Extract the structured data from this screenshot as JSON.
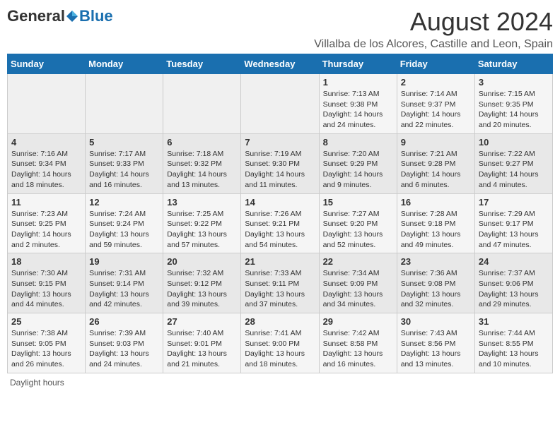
{
  "header": {
    "logo_general": "General",
    "logo_blue": "Blue",
    "main_title": "August 2024",
    "subtitle": "Villalba de los Alcores, Castille and Leon, Spain"
  },
  "weekdays": [
    "Sunday",
    "Monday",
    "Tuesday",
    "Wednesday",
    "Thursday",
    "Friday",
    "Saturday"
  ],
  "weeks": [
    [
      {
        "day": "",
        "sunrise": "",
        "sunset": "",
        "daylight": ""
      },
      {
        "day": "",
        "sunrise": "",
        "sunset": "",
        "daylight": ""
      },
      {
        "day": "",
        "sunrise": "",
        "sunset": "",
        "daylight": ""
      },
      {
        "day": "",
        "sunrise": "",
        "sunset": "",
        "daylight": ""
      },
      {
        "day": "1",
        "sunrise": "Sunrise: 7:13 AM",
        "sunset": "Sunset: 9:38 PM",
        "daylight": "Daylight: 14 hours and 24 minutes."
      },
      {
        "day": "2",
        "sunrise": "Sunrise: 7:14 AM",
        "sunset": "Sunset: 9:37 PM",
        "daylight": "Daylight: 14 hours and 22 minutes."
      },
      {
        "day": "3",
        "sunrise": "Sunrise: 7:15 AM",
        "sunset": "Sunset: 9:35 PM",
        "daylight": "Daylight: 14 hours and 20 minutes."
      }
    ],
    [
      {
        "day": "4",
        "sunrise": "Sunrise: 7:16 AM",
        "sunset": "Sunset: 9:34 PM",
        "daylight": "Daylight: 14 hours and 18 minutes."
      },
      {
        "day": "5",
        "sunrise": "Sunrise: 7:17 AM",
        "sunset": "Sunset: 9:33 PM",
        "daylight": "Daylight: 14 hours and 16 minutes."
      },
      {
        "day": "6",
        "sunrise": "Sunrise: 7:18 AM",
        "sunset": "Sunset: 9:32 PM",
        "daylight": "Daylight: 14 hours and 13 minutes."
      },
      {
        "day": "7",
        "sunrise": "Sunrise: 7:19 AM",
        "sunset": "Sunset: 9:30 PM",
        "daylight": "Daylight: 14 hours and 11 minutes."
      },
      {
        "day": "8",
        "sunrise": "Sunrise: 7:20 AM",
        "sunset": "Sunset: 9:29 PM",
        "daylight": "Daylight: 14 hours and 9 minutes."
      },
      {
        "day": "9",
        "sunrise": "Sunrise: 7:21 AM",
        "sunset": "Sunset: 9:28 PM",
        "daylight": "Daylight: 14 hours and 6 minutes."
      },
      {
        "day": "10",
        "sunrise": "Sunrise: 7:22 AM",
        "sunset": "Sunset: 9:27 PM",
        "daylight": "Daylight: 14 hours and 4 minutes."
      }
    ],
    [
      {
        "day": "11",
        "sunrise": "Sunrise: 7:23 AM",
        "sunset": "Sunset: 9:25 PM",
        "daylight": "Daylight: 14 hours and 2 minutes."
      },
      {
        "day": "12",
        "sunrise": "Sunrise: 7:24 AM",
        "sunset": "Sunset: 9:24 PM",
        "daylight": "Daylight: 13 hours and 59 minutes."
      },
      {
        "day": "13",
        "sunrise": "Sunrise: 7:25 AM",
        "sunset": "Sunset: 9:22 PM",
        "daylight": "Daylight: 13 hours and 57 minutes."
      },
      {
        "day": "14",
        "sunrise": "Sunrise: 7:26 AM",
        "sunset": "Sunset: 9:21 PM",
        "daylight": "Daylight: 13 hours and 54 minutes."
      },
      {
        "day": "15",
        "sunrise": "Sunrise: 7:27 AM",
        "sunset": "Sunset: 9:20 PM",
        "daylight": "Daylight: 13 hours and 52 minutes."
      },
      {
        "day": "16",
        "sunrise": "Sunrise: 7:28 AM",
        "sunset": "Sunset: 9:18 PM",
        "daylight": "Daylight: 13 hours and 49 minutes."
      },
      {
        "day": "17",
        "sunrise": "Sunrise: 7:29 AM",
        "sunset": "Sunset: 9:17 PM",
        "daylight": "Daylight: 13 hours and 47 minutes."
      }
    ],
    [
      {
        "day": "18",
        "sunrise": "Sunrise: 7:30 AM",
        "sunset": "Sunset: 9:15 PM",
        "daylight": "Daylight: 13 hours and 44 minutes."
      },
      {
        "day": "19",
        "sunrise": "Sunrise: 7:31 AM",
        "sunset": "Sunset: 9:14 PM",
        "daylight": "Daylight: 13 hours and 42 minutes."
      },
      {
        "day": "20",
        "sunrise": "Sunrise: 7:32 AM",
        "sunset": "Sunset: 9:12 PM",
        "daylight": "Daylight: 13 hours and 39 minutes."
      },
      {
        "day": "21",
        "sunrise": "Sunrise: 7:33 AM",
        "sunset": "Sunset: 9:11 PM",
        "daylight": "Daylight: 13 hours and 37 minutes."
      },
      {
        "day": "22",
        "sunrise": "Sunrise: 7:34 AM",
        "sunset": "Sunset: 9:09 PM",
        "daylight": "Daylight: 13 hours and 34 minutes."
      },
      {
        "day": "23",
        "sunrise": "Sunrise: 7:36 AM",
        "sunset": "Sunset: 9:08 PM",
        "daylight": "Daylight: 13 hours and 32 minutes."
      },
      {
        "day": "24",
        "sunrise": "Sunrise: 7:37 AM",
        "sunset": "Sunset: 9:06 PM",
        "daylight": "Daylight: 13 hours and 29 minutes."
      }
    ],
    [
      {
        "day": "25",
        "sunrise": "Sunrise: 7:38 AM",
        "sunset": "Sunset: 9:05 PM",
        "daylight": "Daylight: 13 hours and 26 minutes."
      },
      {
        "day": "26",
        "sunrise": "Sunrise: 7:39 AM",
        "sunset": "Sunset: 9:03 PM",
        "daylight": "Daylight: 13 hours and 24 minutes."
      },
      {
        "day": "27",
        "sunrise": "Sunrise: 7:40 AM",
        "sunset": "Sunset: 9:01 PM",
        "daylight": "Daylight: 13 hours and 21 minutes."
      },
      {
        "day": "28",
        "sunrise": "Sunrise: 7:41 AM",
        "sunset": "Sunset: 9:00 PM",
        "daylight": "Daylight: 13 hours and 18 minutes."
      },
      {
        "day": "29",
        "sunrise": "Sunrise: 7:42 AM",
        "sunset": "Sunset: 8:58 PM",
        "daylight": "Daylight: 13 hours and 16 minutes."
      },
      {
        "day": "30",
        "sunrise": "Sunrise: 7:43 AM",
        "sunset": "Sunset: 8:56 PM",
        "daylight": "Daylight: 13 hours and 13 minutes."
      },
      {
        "day": "31",
        "sunrise": "Sunrise: 7:44 AM",
        "sunset": "Sunset: 8:55 PM",
        "daylight": "Daylight: 13 hours and 10 minutes."
      }
    ]
  ],
  "footer": {
    "note": "Daylight hours"
  }
}
